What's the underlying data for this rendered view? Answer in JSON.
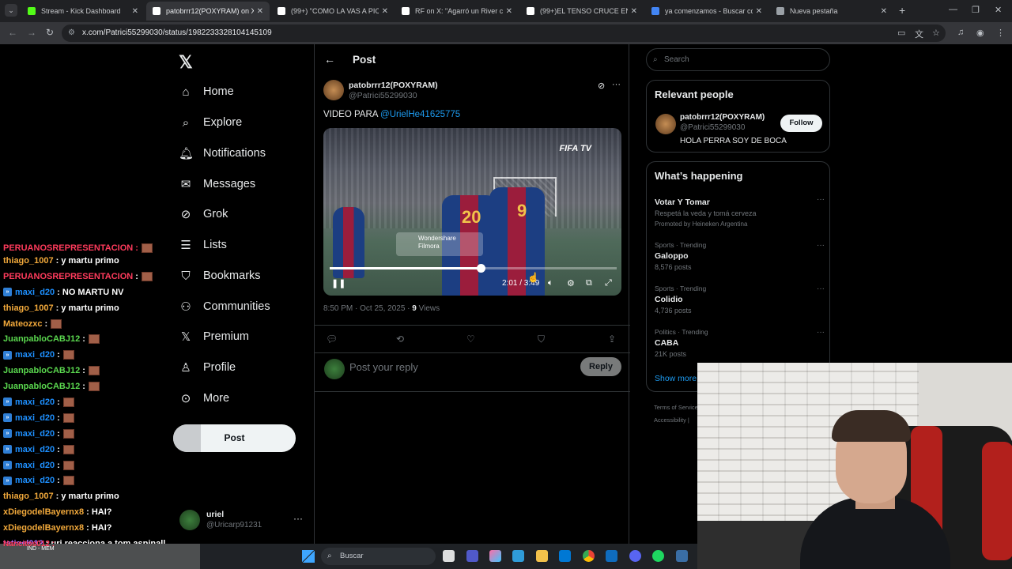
{
  "browser": {
    "tabs": [
      {
        "label": "Stream - Kick Dashboard",
        "favicon": "kick-icon",
        "color": "#53fc18"
      },
      {
        "label": "patobrrr12(POXYRAM) on X",
        "favicon": "x-icon",
        "color": "#ffffff",
        "active": true
      },
      {
        "label": "(99+) \"COMO LA VAS A PICAR",
        "favicon": "tiktok-icon",
        "color": "#ffffff"
      },
      {
        "label": "RF on X: \"Agarró un River camp",
        "favicon": "x-icon",
        "color": "#ffffff"
      },
      {
        "label": "(99+)EL TENSO CRUCE ENTRE",
        "favicon": "tiktok-icon",
        "color": "#ffffff"
      },
      {
        "label": "ya comenzamos - Buscar con G",
        "favicon": "google-icon",
        "color": "#4285f4"
      },
      {
        "label": "Nueva pestaña",
        "favicon": "chrome-icon",
        "color": "#9aa0a6"
      }
    ],
    "url": "x.com/Patrici55299030/status/1982233328104145109"
  },
  "chat": {
    "partial_top": "PERUANOSREPRESENTACION :",
    "messages": [
      {
        "user": "thiago_1007",
        "color": "#f2a93b",
        "text": ": y martu primo",
        "badge": false,
        "emote": false
      },
      {
        "user": "PERUANOSREPRESENTACION",
        "color": "#ff3b5c",
        "text": ":",
        "badge": false,
        "emote": true
      },
      {
        "user": "maxi_d20",
        "color": "#1e90ff",
        "text": ": NO MARTU NV",
        "badge": true,
        "emote": false
      },
      {
        "user": "thiago_1007",
        "color": "#f2a93b",
        "text": ": y martu primo",
        "badge": false,
        "emote": false
      },
      {
        "user": "Mateozxc",
        "color": "#f2a93b",
        "text": ":",
        "badge": false,
        "emote": true
      },
      {
        "user": "JuanpabloCABJ12",
        "color": "#5bd94f",
        "text": ":",
        "badge": false,
        "emote": true
      },
      {
        "user": "maxi_d20",
        "color": "#1e90ff",
        "text": ":",
        "badge": true,
        "emote": true
      },
      {
        "user": "JuanpabloCABJ12",
        "color": "#5bd94f",
        "text": ":",
        "badge": false,
        "emote": true
      },
      {
        "user": "JuanpabloCABJ12",
        "color": "#5bd94f",
        "text": ":",
        "badge": false,
        "emote": true
      },
      {
        "user": "maxi_d20",
        "color": "#1e90ff",
        "text": ":",
        "badge": true,
        "emote": true
      },
      {
        "user": "maxi_d20",
        "color": "#1e90ff",
        "text": ":",
        "badge": true,
        "emote": true
      },
      {
        "user": "maxi_d20",
        "color": "#1e90ff",
        "text": ":",
        "badge": true,
        "emote": true
      },
      {
        "user": "maxi_d20",
        "color": "#1e90ff",
        "text": ":",
        "badge": true,
        "emote": true
      },
      {
        "user": "maxi_d20",
        "color": "#1e90ff",
        "text": ":",
        "badge": true,
        "emote": true
      },
      {
        "user": "maxi_d20",
        "color": "#1e90ff",
        "text": ":",
        "badge": true,
        "emote": true
      },
      {
        "user": "thiago_1007",
        "color": "#f2a93b",
        "text": ": y martu primo",
        "badge": false,
        "emote": false
      },
      {
        "user": "xDiegodelBayernx8",
        "color": "#f2a93b",
        "text": ": HAI?",
        "badge": false,
        "emote": false
      },
      {
        "user": "xDiegodelBayernx8",
        "color": "#f2a93b",
        "text": ": HAI?",
        "badge": false,
        "emote": false
      },
      {
        "user": "tatigel012",
        "color": "#b26cff",
        "text": ": uri reacciona a tom aspinall",
        "badge": false,
        "emote": false
      }
    ],
    "partial_bottom": "Nancitos012 :"
  },
  "nav": {
    "items": [
      {
        "label": "Home",
        "icon": "home-icon",
        "glyph": "⌂"
      },
      {
        "label": "Explore",
        "icon": "search-icon",
        "glyph": "⌕"
      },
      {
        "label": "Notifications",
        "icon": "bell-icon",
        "glyph": "🔔︎"
      },
      {
        "label": "Messages",
        "icon": "mail-icon",
        "glyph": "✉"
      },
      {
        "label": "Grok",
        "icon": "grok-icon",
        "glyph": "⊘"
      },
      {
        "label": "Lists",
        "icon": "list-icon",
        "glyph": "☰"
      },
      {
        "label": "Bookmarks",
        "icon": "bookmark-icon",
        "glyph": "⛉"
      },
      {
        "label": "Communities",
        "icon": "communities-icon",
        "glyph": "⚇"
      },
      {
        "label": "Premium",
        "icon": "x-premium-icon",
        "glyph": "𝕏"
      },
      {
        "label": "Profile",
        "icon": "person-icon",
        "glyph": "♙"
      },
      {
        "label": "More",
        "icon": "more-circle-icon",
        "glyph": "⊙"
      }
    ],
    "post_label": "Post",
    "account": {
      "name": "uriel",
      "handle": "@Uricarp91231"
    }
  },
  "post": {
    "header": "Post",
    "author_name": "patobrrr12(POXYRAM)",
    "author_handle": "@Patrici55299030",
    "text": "VIDEO PARA ",
    "mention": "@UrielHe41625775",
    "video": {
      "watermark": "FIFA TV",
      "jersey_left": "20",
      "jersey_right": "9",
      "editor_watermark": "Wondershare\nFilmora",
      "time": "2:01 / 3:49",
      "progress": 0.526
    },
    "timestamp": "8:50 PM · Oct 25, 2025 · ",
    "views_count": "9",
    "views_label": " Views",
    "reply_placeholder": "Post your reply",
    "reply_button": "Reply"
  },
  "sidebar": {
    "search_placeholder": "Search",
    "relevant_title": "Relevant people",
    "person": {
      "name": "patobrrr12(POXYRAM)",
      "handle": "@Patrici55299030",
      "bio": "HOLA PERRA SOY DE BOCA",
      "follow": "Follow"
    },
    "happening_title": "What’s happening",
    "trends": [
      {
        "context": "",
        "name": "Votar Y Tomar",
        "sub": "Respetá la veda y tomá cerveza",
        "promo": "Promoted by Heineken Argentina"
      },
      {
        "context": "Sports · Trending",
        "name": "Galoppo",
        "sub": "8,576 posts",
        "promo": ""
      },
      {
        "context": "Sports · Trending",
        "name": "Colidio",
        "sub": "4,736 posts",
        "promo": ""
      },
      {
        "context": "Politics · Trending",
        "name": "CABA",
        "sub": "21K posts",
        "promo": ""
      }
    ],
    "show_more": "Show more",
    "footer1": "Terms of Service",
    "footer2": "Accessibility  |"
  },
  "taskbar": {
    "search_placeholder": "Buscar",
    "widget_text": "IND - MEM"
  }
}
